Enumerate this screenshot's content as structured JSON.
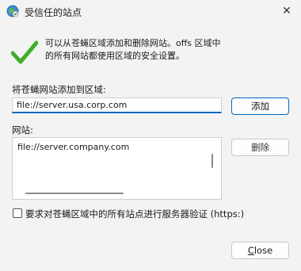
{
  "window": {
    "title": "受信任的站点",
    "close_glyph": "✕"
  },
  "info": {
    "line1": "可以从苍蝇区域添加和删除网站。offs 区域中",
    "line2": "的所有网站都使用区域的安全设置。"
  },
  "add_site": {
    "label": "将苍蝇网站添加到区域:",
    "value": "file://server.usa.corp.com",
    "button_label": "添加"
  },
  "sites": {
    "label": "网站:",
    "items": [
      "file://server.company.com"
    ],
    "remove_label": "删除"
  },
  "https_requirement": {
    "label": "要求对苍蝇区域中的所有站点进行服务器验证 (https:)",
    "checked": false
  },
  "footer": {
    "close_label_accel": "C",
    "close_label_rest": "lose"
  },
  "colors": {
    "accent": "#0067c0",
    "check_green": "#3fae2a",
    "background": "#f3f3f3"
  },
  "icons": [
    "globe-icon",
    "close-icon",
    "checkmark-icon"
  ]
}
